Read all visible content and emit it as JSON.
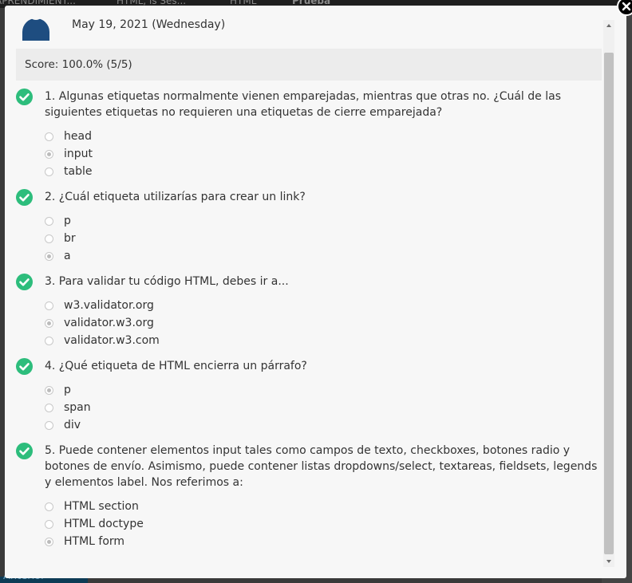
{
  "background": {
    "nav_items": [
      "APRENDIMIENT...",
      "HTML, is Ses...",
      "HTML",
      "Prueba"
    ],
    "bottom_text": "Anterior"
  },
  "result": {
    "date": "May 19, 2021 (Wednesday)",
    "score": "Score: 100.0% (5/5)"
  },
  "questions": [
    {
      "text": "1. Algunas etiquetas normalmente vienen emparejadas, mientras que otras no. ¿Cuál de las siguientes etiquetas no requieren una etiquetas de cierre emparejada?",
      "options": [
        "head",
        "input",
        "table"
      ],
      "selected": 1,
      "correct": true
    },
    {
      "text": "2. ¿Cuál etiqueta utilizarías para crear un link?",
      "options": [
        "p",
        "br",
        "a"
      ],
      "selected": 2,
      "correct": true
    },
    {
      "text": "3. Para validar tu código HTML, debes ir a...",
      "options": [
        "w3.validator.org",
        "validator.w3.org",
        "validator.w3.com"
      ],
      "selected": 1,
      "correct": true
    },
    {
      "text": "4. ¿Qué etiqueta de HTML encierra un párrafo?",
      "options": [
        "p",
        "span",
        "div"
      ],
      "selected": 0,
      "correct": true
    },
    {
      "text": "5. Puede contener elementos input tales como campos de texto, checkboxes, botones radio y botones de envío. Asimismo, puede contener listas dropdowns/select, textareas, fieldsets, legends y elementos label. Nos referimos a:",
      "options": [
        "HTML section",
        "HTML doctype",
        "HTML form"
      ],
      "selected": 2,
      "correct": true
    }
  ],
  "colors": {
    "correct_check": "#2dbd7c",
    "avatar": "#1e4d80",
    "score_bar": "#ececec"
  },
  "icons": {
    "correct": "check-circle-icon",
    "close": "close-icon"
  }
}
